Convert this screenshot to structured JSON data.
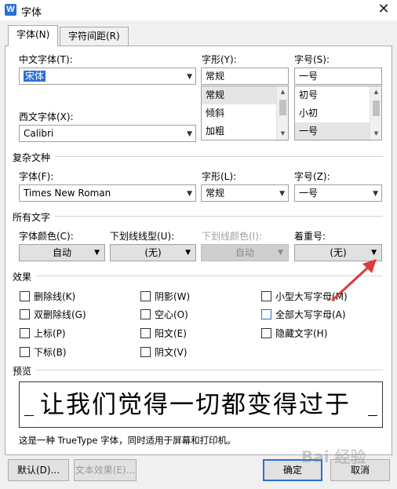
{
  "window": {
    "title": "字体",
    "app_icon": "W"
  },
  "tabs": [
    {
      "label": "字体(N)"
    },
    {
      "label": "字符间距(R)"
    }
  ],
  "chinese_font": {
    "label": "中文字体(T):",
    "value": "宋体"
  },
  "style": {
    "label": "字形(Y):",
    "value": "常规",
    "options": [
      "常规",
      "倾斜",
      "加粗"
    ]
  },
  "size": {
    "label": "字号(S):",
    "value": "一号",
    "options": [
      "初号",
      "小初",
      "一号"
    ]
  },
  "western_font": {
    "label": "西文字体(X):",
    "value": "Calibri"
  },
  "complex": {
    "section_title": "复杂文种",
    "font_label": "字体(F):",
    "font_value": "Times New Roman",
    "style_label": "字形(L):",
    "style_value": "常规",
    "size_label": "字号(Z):",
    "size_value": "一号"
  },
  "all_text": {
    "section_title": "所有文字",
    "font_color_label": "字体颜色(C):",
    "font_color_value": "自动",
    "underline_type_label": "下划线线型(U):",
    "underline_type_value": "(无)",
    "underline_color_label": "下划线颜色(I):",
    "underline_color_value": "自动",
    "emphasis_label": "着重号:",
    "emphasis_value": "(无)"
  },
  "effects": {
    "section_title": "效果",
    "items": [
      {
        "label": "删除线(K)"
      },
      {
        "label": "双删除线(G)"
      },
      {
        "label": "上标(P)"
      },
      {
        "label": "下标(B)"
      },
      {
        "label": "阴影(W)"
      },
      {
        "label": "空心(O)"
      },
      {
        "label": "阳文(E)"
      },
      {
        "label": "阴文(V)"
      },
      {
        "label": "小型大写字母(M)"
      },
      {
        "label": "全部大写字母(A)"
      },
      {
        "label": "隐藏文字(H)"
      }
    ]
  },
  "preview": {
    "section_title": "预览",
    "sample_text": "让我们觉得一切都变得过于",
    "note": "这是一种 TrueType 字体，同时适用于屏幕和打印机。"
  },
  "buttons": {
    "default": "默认(D)...",
    "text_effects": "文本效果(E)...",
    "ok": "确定",
    "cancel": "取消"
  },
  "colors": {
    "accent": "#2a6fd6",
    "arrow": "#e0393a"
  }
}
